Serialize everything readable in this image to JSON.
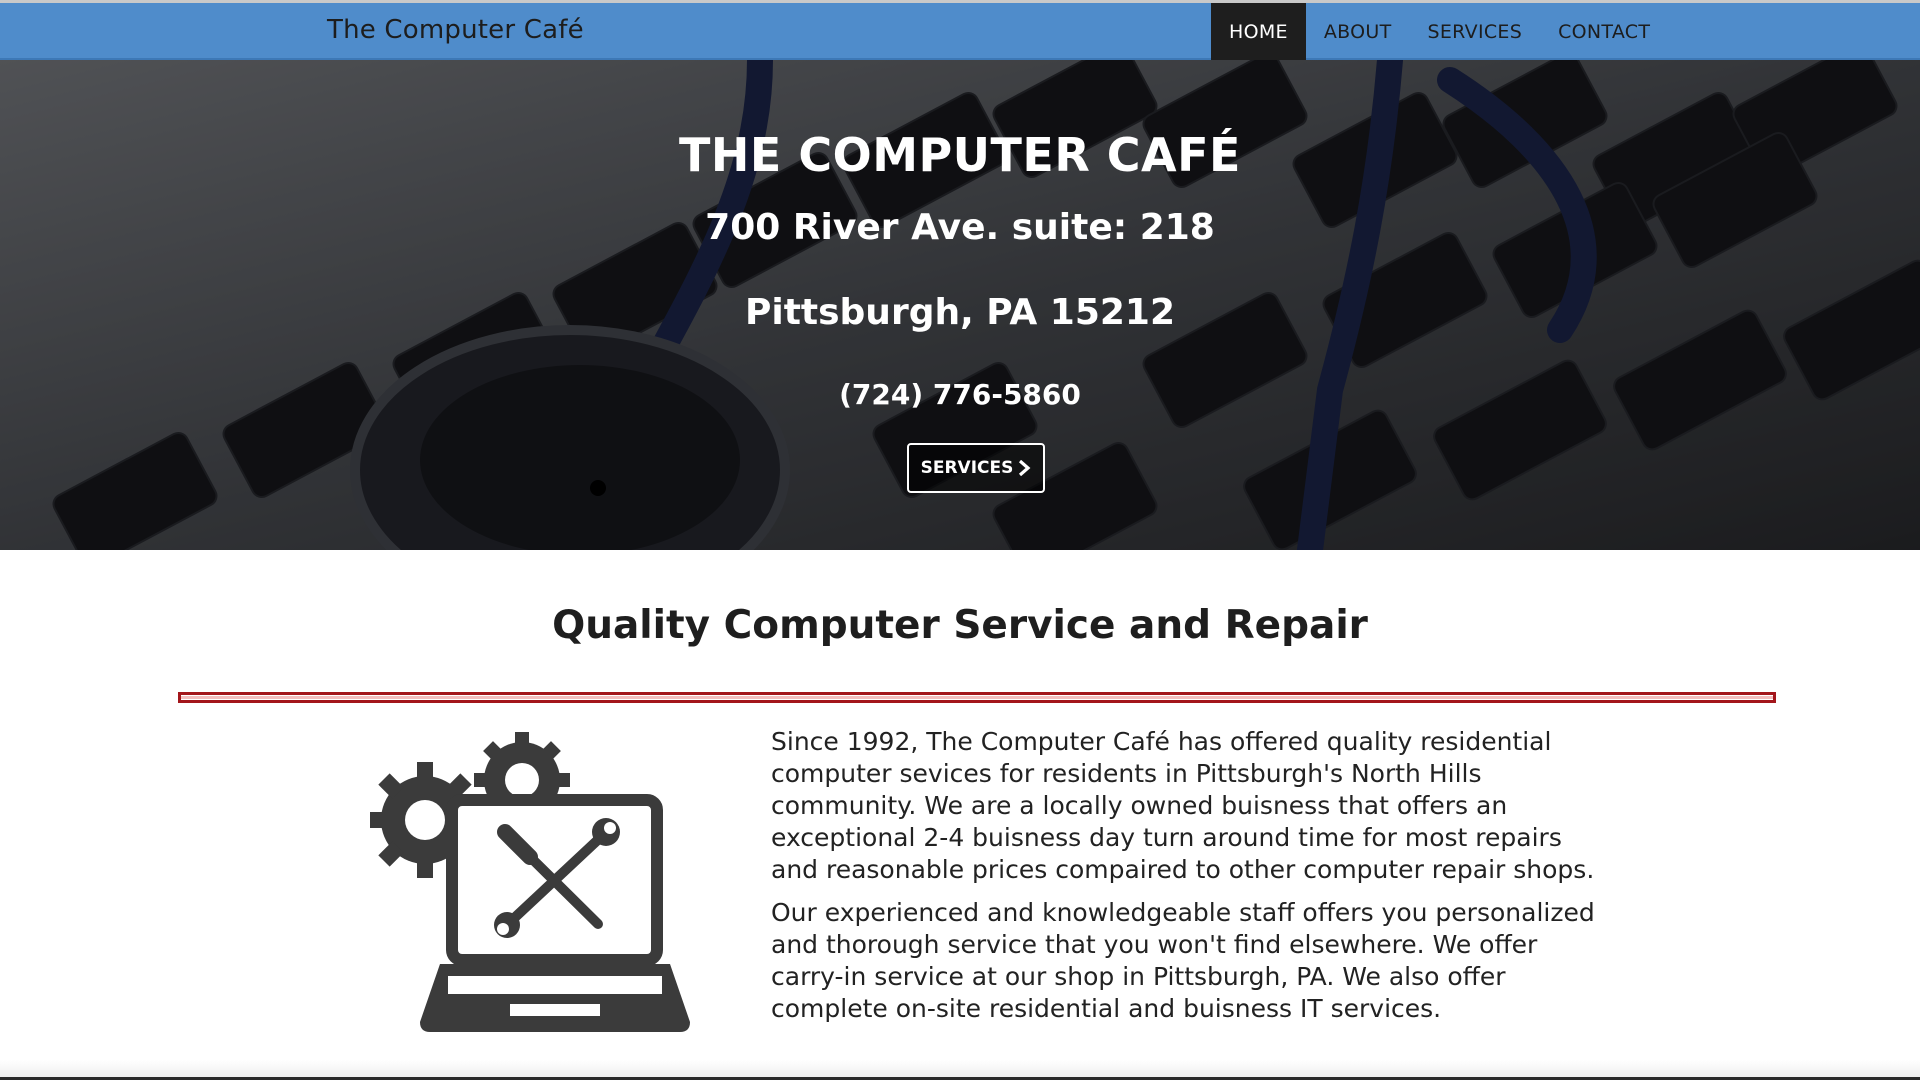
{
  "navbar": {
    "brand": "The Computer Café",
    "links": [
      {
        "label": "HOME",
        "active": true
      },
      {
        "label": "ABOUT",
        "active": false
      },
      {
        "label": "SERVICES",
        "active": false
      },
      {
        "label": "CONTACT",
        "active": false
      }
    ]
  },
  "hero": {
    "title": "THE COMPUTER CAFÉ",
    "address_line1": "700 River Ave. suite: 218",
    "address_line2": "Pittsburgh, PA 15212",
    "phone": "(724) 776-5860",
    "button_label": "SERVICES",
    "button_icon": "chevron-right-icon"
  },
  "intro": {
    "heading": "Quality Computer Service and Repair",
    "paragraph1": "Since 1992, The Computer Café has offered quality residential computer sevices for residents in Pittsburgh's North Hills community. We are a locally owned buisness that offers an exceptional 2-4 buisness day turn around time for most repairs and reasonable prices compaired to other computer repair shops.",
    "paragraph2": "Our experienced and knowledgeable staff offers you personalized and thorough service that you won't find elsewhere. We offer carry-in service at our shop in Pittsburgh, PA. We also offer complete on-site residential and buisness IT services.",
    "illustration_icon": "laptop-repair-gears-icon"
  },
  "colors": {
    "navbar_bg": "#4f8ccb",
    "nav_active_bg": "#1e1e1e",
    "divider": "#a3161b",
    "text": "#222222"
  }
}
